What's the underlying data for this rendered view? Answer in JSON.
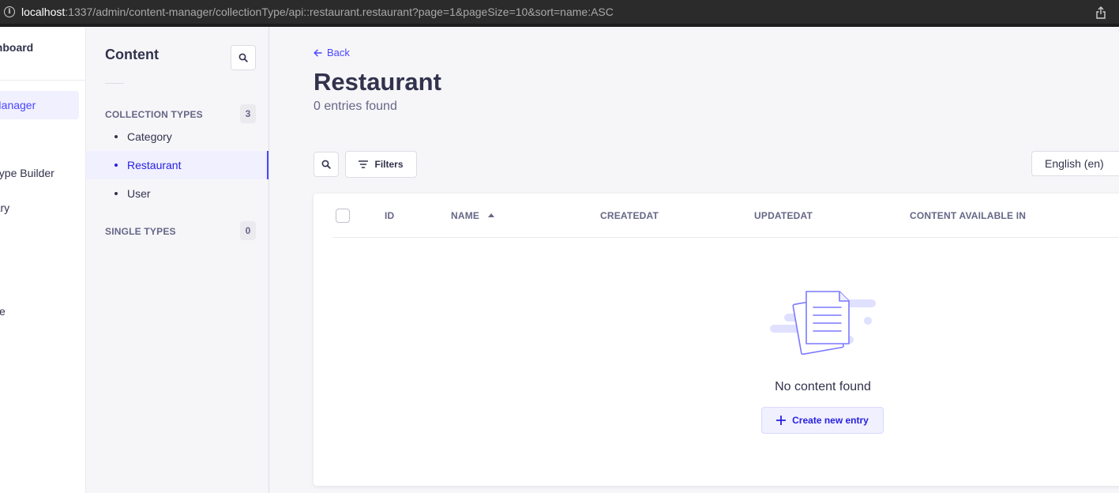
{
  "browser": {
    "url_host": "localhost",
    "url_path": ":1337/admin/content-manager/collectionType/api::restaurant.restaurant?page=1&pageSize=10&sort=name:ASC"
  },
  "main_nav": {
    "brand": "shboard",
    "items": [
      {
        "label": "Manager",
        "active": true
      },
      {
        "label": "Type Builder"
      },
      {
        "label": "rary"
      },
      {
        "label": "ce"
      }
    ]
  },
  "sub_nav": {
    "title": "Content",
    "collection_types": {
      "label": "COLLECTION TYPES",
      "count": "3",
      "items": [
        "Category",
        "Restaurant",
        "User"
      ]
    },
    "single_types": {
      "label": "SINGLE TYPES",
      "count": "0"
    }
  },
  "header": {
    "back_label": "Back",
    "title": "Restaurant",
    "subtitle": "0 entries found"
  },
  "toolbar": {
    "filters_label": "Filters",
    "locale": "English (en)"
  },
  "table": {
    "columns": [
      "ID",
      "NAME",
      "CREATEDAT",
      "UPDATEDAT",
      "CONTENT AVAILABLE IN"
    ]
  },
  "empty_state": {
    "message": "No content found",
    "create_label": "Create new entry"
  },
  "colors": {
    "primary": "#4945ff",
    "primary_dark": "#271fe0",
    "primary_light": "#f0f0ff",
    "text": "#32324d",
    "muted": "#666687"
  }
}
